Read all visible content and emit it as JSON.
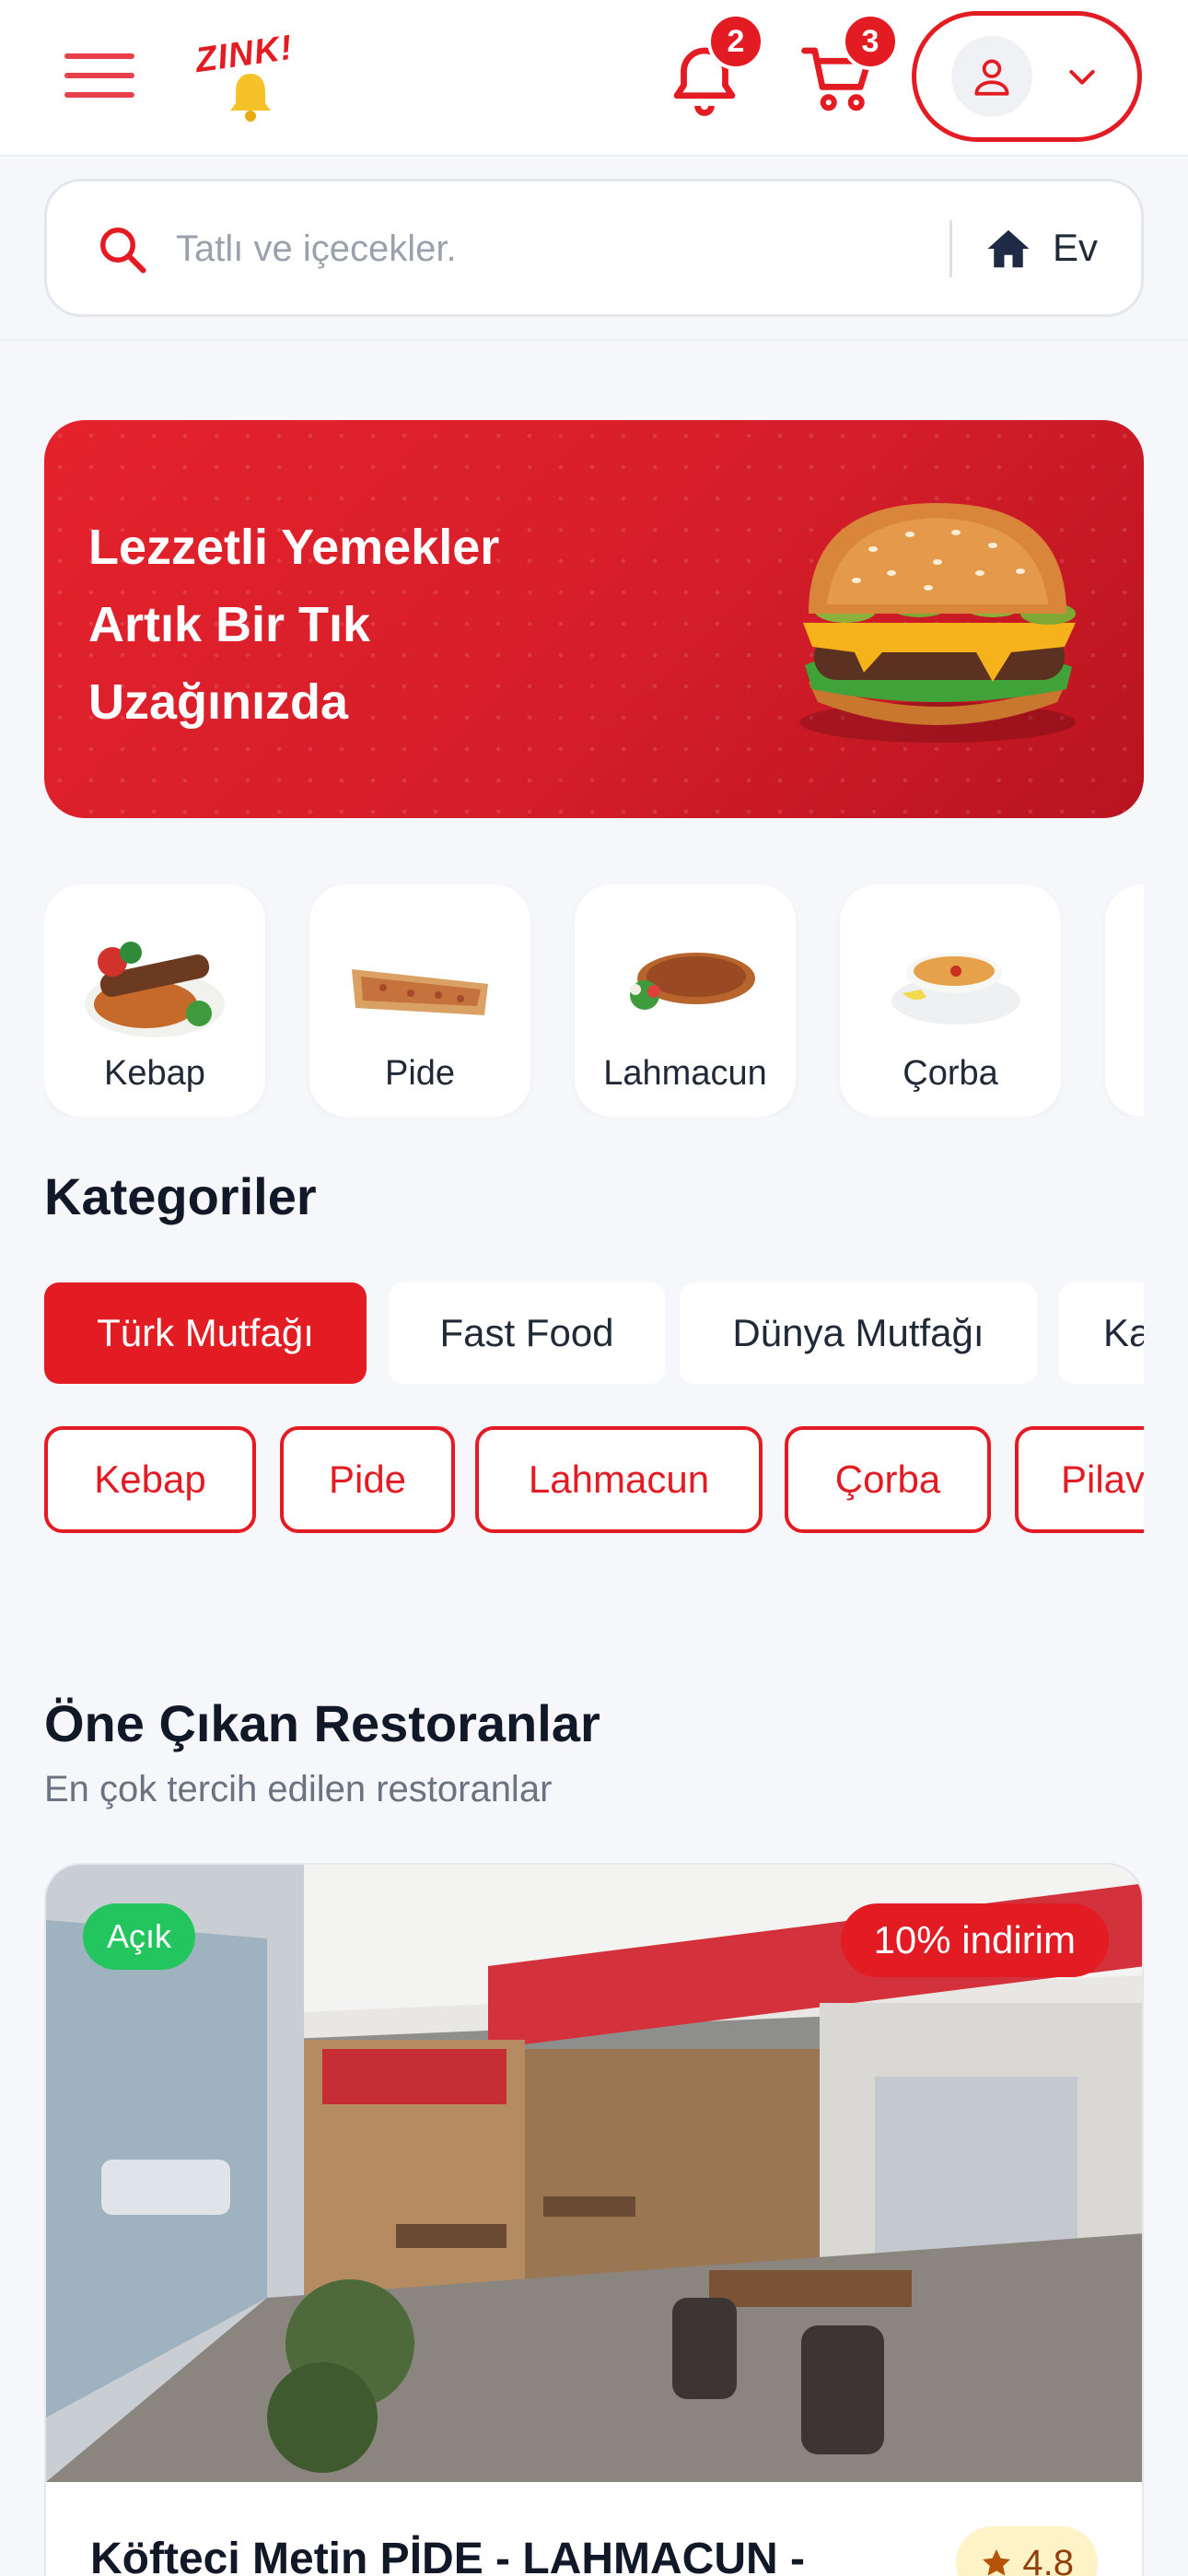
{
  "header": {
    "logo_text": "ZINK!",
    "notifications_count": "2",
    "cart_count": "3",
    "icons": [
      "menu-icon",
      "bell-icon",
      "cart-icon",
      "user-icon",
      "chevron-down-icon"
    ]
  },
  "search": {
    "placeholder": "Tatlı ve içecekler.",
    "address_label": "Ev"
  },
  "hero": {
    "title": "Lezzetli Yemekler Artık Bir Tık Uzağınızda"
  },
  "quick_categories": [
    {
      "label": "Kebap"
    },
    {
      "label": "Pide"
    },
    {
      "label": "Lahmacun"
    },
    {
      "label": "Çorba"
    }
  ],
  "categories": {
    "title": "Kategoriler",
    "tabs": [
      {
        "label": "Türk Mutfağı",
        "active": true
      },
      {
        "label": "Fast Food",
        "active": false
      },
      {
        "label": "Dünya Mutfağı",
        "active": false
      },
      {
        "label": "Ka",
        "active": false
      }
    ],
    "chips": [
      {
        "label": "Kebap"
      },
      {
        "label": "Pide"
      },
      {
        "label": "Lahmacun"
      },
      {
        "label": "Çorba"
      },
      {
        "label": "Pilav"
      }
    ]
  },
  "featured": {
    "title": "Öne Çıkan Restoranlar",
    "subtitle": "En çok tercih edilen restoranlar",
    "restaurants": [
      {
        "status": "Açık",
        "discount": "10% indirim",
        "name": "Köfteci Metin PİDE - LAHMACUN -",
        "rating": "4.8"
      }
    ]
  },
  "colors": {
    "brand_red": "#e31b23",
    "open_green": "#22c55e",
    "background": "#f5f7fa"
  }
}
